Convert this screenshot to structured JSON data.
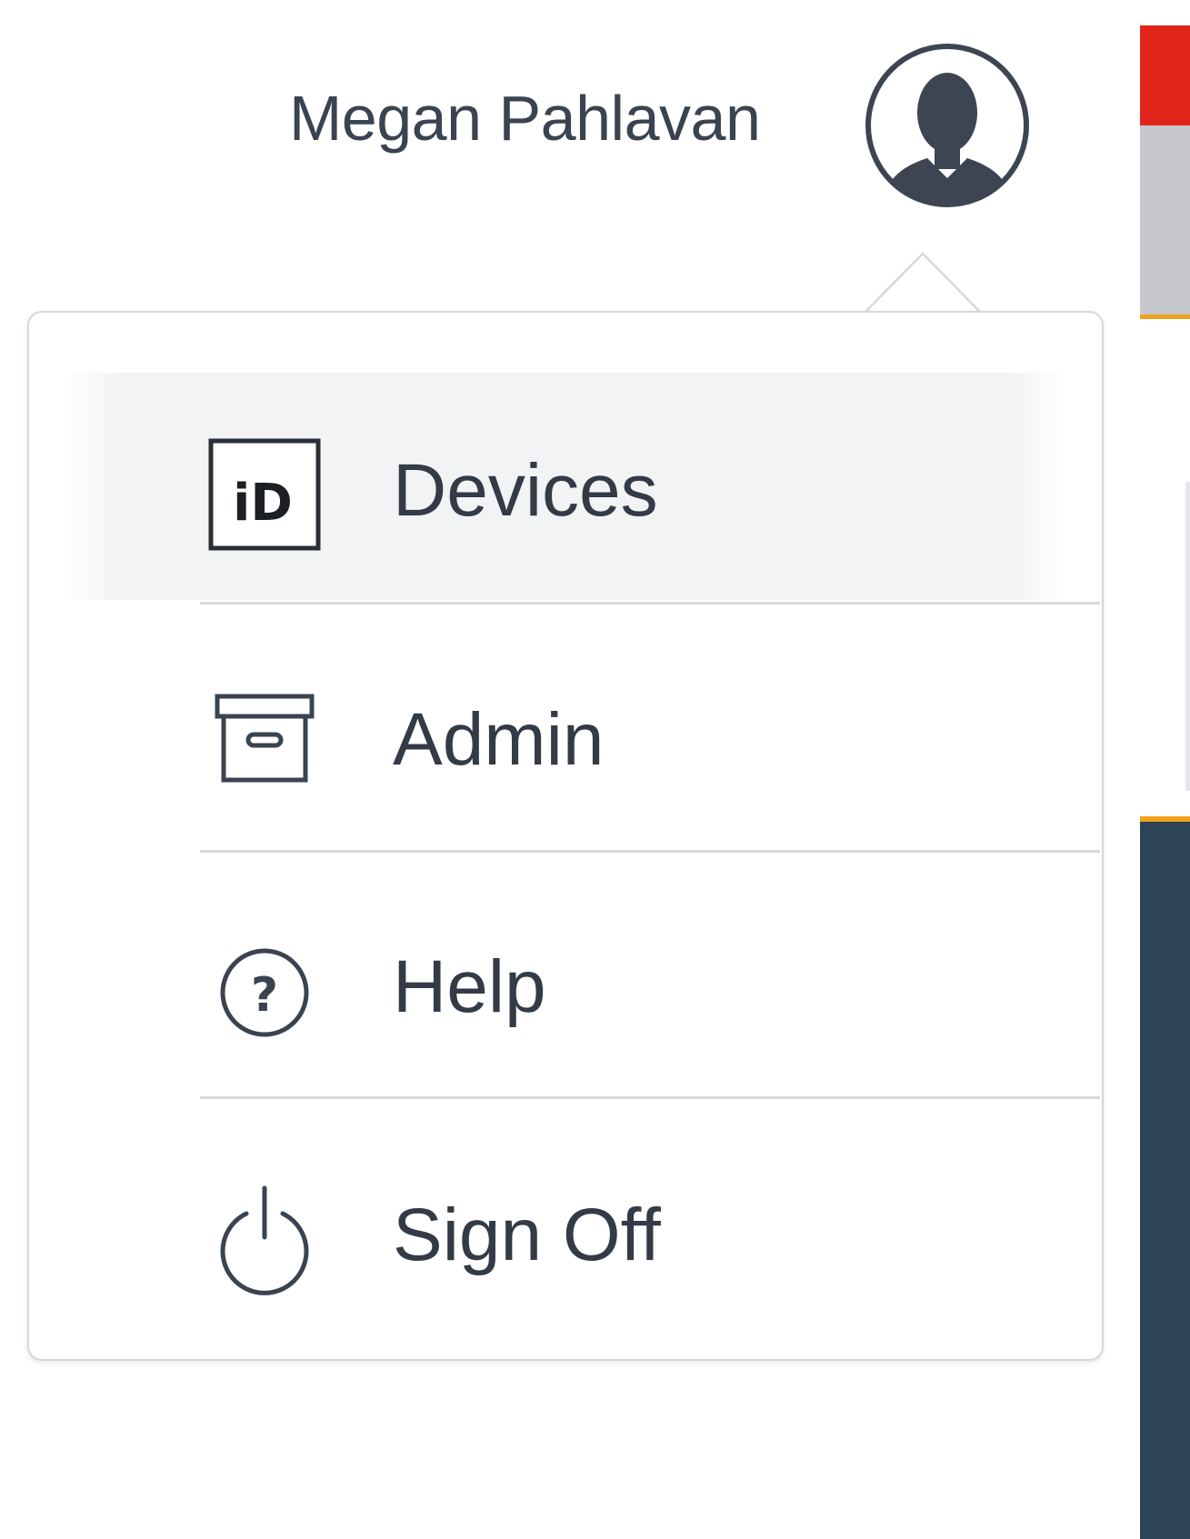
{
  "header": {
    "user_name": "Megan Pahlavan",
    "avatar_icon": "user-silhouette-icon"
  },
  "menu": {
    "items": [
      {
        "label": "Devices",
        "icon": "id-card-icon",
        "active": true
      },
      {
        "label": "Admin",
        "icon": "archive-box-icon",
        "active": false
      },
      {
        "label": "Help",
        "icon": "help-circle-icon",
        "active": false
      },
      {
        "label": "Sign Off",
        "icon": "power-icon",
        "active": false
      }
    ]
  },
  "colors": {
    "text": "#333b47",
    "divider": "#d7d9dc",
    "active_bg": "#f2f3f5",
    "edge_red": "#e1251b",
    "edge_grey": "#c6c8cc",
    "edge_accent": "#f0a21e",
    "edge_navy": "#2d4356"
  }
}
